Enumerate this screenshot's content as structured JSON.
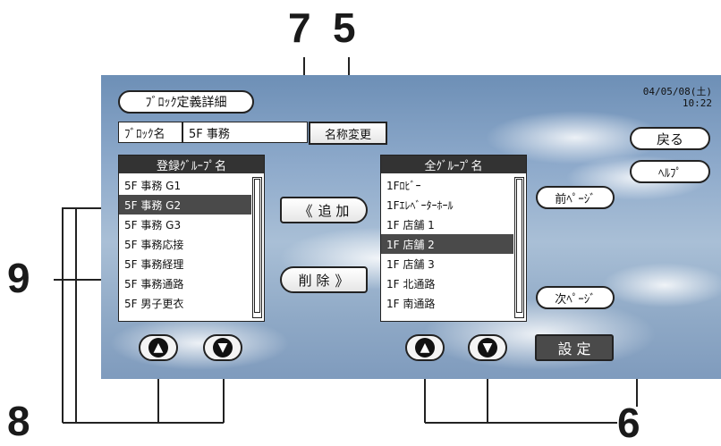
{
  "callouts": {
    "c7": "7",
    "c5": "5",
    "c9": "9",
    "c8": "8",
    "c6": "6"
  },
  "screen": {
    "title": "ﾌﾞﾛｯｸ定義詳細",
    "datetime": {
      "date": "04/05/08(土)",
      "time": "10:22"
    },
    "block_label": "ﾌﾞﾛｯｸ名",
    "block_name": "5F 事務",
    "rename_button": "名称変更",
    "back_button": "戻る",
    "help_button": "ﾍﾙﾌﾟ",
    "prev_page_button": "前ﾍﾟｰｼﾞ",
    "next_page_button": "次ﾍﾟｰｼﾞ",
    "add_button": "追 加",
    "delete_button": "削 除",
    "set_button": "設 定",
    "registered_list": {
      "header": "登録ｸﾞﾙｰﾌﾟ名",
      "items": [
        "5F 事務 G1",
        "5F 事務 G2",
        "5F 事務 G3",
        "5F 事務応接",
        "5F 事務経理",
        "5F 事務通路",
        "5F 男子更衣"
      ],
      "selected_index": 1
    },
    "all_list": {
      "header": "全ｸﾞﾙｰﾌﾟ名",
      "items": [
        "1Fﾛﾋﾞｰ",
        "1Fｴﾚﾍﾞｰﾀｰﾎｰﾙ",
        "1F 店舗 1",
        "1F 店舗 2",
        "1F 店舗 3",
        "1F 北通路",
        "1F 南通路"
      ],
      "selected_index": 3
    },
    "icons": {
      "up": "arrow-up-icon",
      "down": "arrow-down-icon",
      "add": "double-chevron-left-icon",
      "delete": "double-chevron-right-icon"
    }
  }
}
